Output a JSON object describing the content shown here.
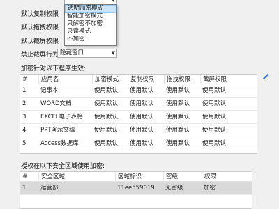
{
  "form": {
    "rows": [
      {
        "label": "默认复制权限"
      },
      {
        "label": "默认拖拽权限"
      },
      {
        "label": "默认截屏权限"
      },
      {
        "label": "禁止截屏行为",
        "value": "隐藏窗口"
      }
    ],
    "dropdown_options": [
      "透明加密模式",
      "智能加密模式",
      "只解密不加密",
      "只读模式",
      "不加密"
    ],
    "highlighted_index": 0
  },
  "programs": {
    "title": "加密针对以下程序生效:",
    "columns": [
      "#",
      "应用名",
      "加密模式",
      "复制权限",
      "拖拽权限",
      "截屏权限"
    ],
    "rows": [
      [
        "1",
        "记事本",
        "使用默认",
        "使用默认",
        "使用默认",
        "使用默认"
      ],
      [
        "2",
        "WORD文档",
        "使用默认",
        "使用默认",
        "使用默认",
        "使用默认"
      ],
      [
        "3",
        "EXCEL电子表格",
        "使用默认",
        "使用默认",
        "使用默认",
        "使用默认"
      ],
      [
        "4",
        "PPT演示文稿",
        "使用默认",
        "使用默认",
        "使用默认",
        "使用默认"
      ],
      [
        "5",
        "Access数据库",
        "使用默认",
        "使用默认",
        "使用默认",
        "使用默认"
      ]
    ]
  },
  "zones": {
    "title": "授权在以下安全区域使用加密:",
    "columns": [
      "#",
      "安全区域",
      "区域标识",
      "密级",
      "权限"
    ],
    "rows": [
      [
        "1",
        "运营部",
        "11ee559019",
        "无密级",
        "加密"
      ]
    ]
  },
  "colors": {
    "accent": "#2f6fd6",
    "selected_row": "#d9d9d9",
    "highlight": "#cce4f7"
  },
  "icons": {
    "edit": "pencil-icon",
    "dropdown": "chevron-down-icon"
  }
}
